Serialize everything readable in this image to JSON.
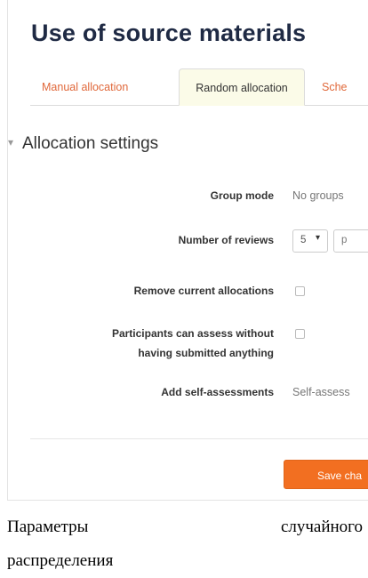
{
  "page": {
    "title": "Use of source materials"
  },
  "tabs": [
    {
      "label": "Manual allocation",
      "active": false
    },
    {
      "label": "Random allocation",
      "active": true
    },
    {
      "label": "Sche",
      "active": false
    }
  ],
  "section": {
    "legend": "Allocation settings",
    "collapse_icon": "triangle-down-icon"
  },
  "form": {
    "group_mode": {
      "label": "Group mode",
      "value": "No groups"
    },
    "num_reviews": {
      "label": "Number of reviews",
      "value": "5",
      "second_value": "p"
    },
    "remove_current": {
      "label": "Remove current allocations",
      "checked": false
    },
    "assess_without": {
      "label_line1": "Participants can assess without",
      "label_line2": "having submitted anything",
      "checked": false
    },
    "self_assess": {
      "label": "Add self-assessments",
      "value": "Self-assess"
    }
  },
  "buttons": {
    "save_label": "Save cha"
  },
  "caption": {
    "word1": "Параметры",
    "word2": "случайного",
    "line2": "распределения"
  },
  "colors": {
    "accent": "#f26f21",
    "tab_link": "#e0683a",
    "active_tab_bg": "#fbfbe8",
    "title": "#1f2a44"
  }
}
